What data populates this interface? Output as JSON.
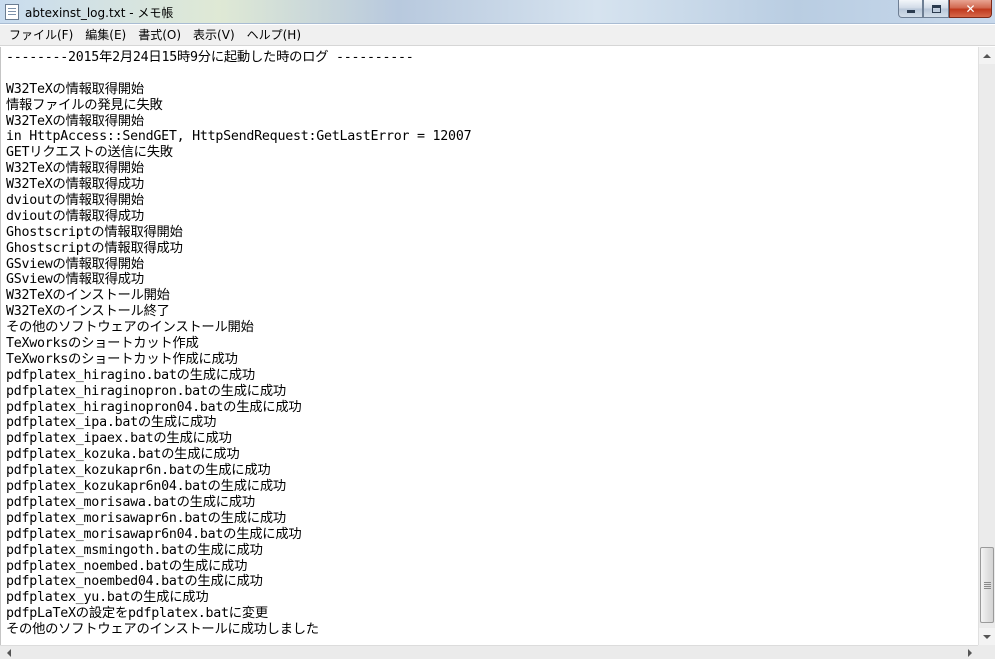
{
  "window": {
    "title": "abtexinst_log.txt - メモ帳",
    "icon": "notepad-icon"
  },
  "menu": [
    {
      "label": "ファイル(F)"
    },
    {
      "label": "編集(E)"
    },
    {
      "label": "書式(O)"
    },
    {
      "label": "表示(V)"
    },
    {
      "label": "ヘルプ(H)"
    }
  ],
  "document": {
    "lines": [
      "--------2015年2月24日15時9分に起動した時のログ ----------",
      "",
      "W32TeXの情報取得開始",
      "情報ファイルの発見に失敗",
      "W32TeXの情報取得開始",
      "in HttpAccess::SendGET, HttpSendRequest:GetLastError = 12007",
      "GETリクエストの送信に失敗",
      "W32TeXの情報取得開始",
      "W32TeXの情報取得成功",
      "dvioutの情報取得開始",
      "dvioutの情報取得成功",
      "Ghostscriptの情報取得開始",
      "Ghostscriptの情報取得成功",
      "GSviewの情報取得開始",
      "GSviewの情報取得成功",
      "W32TeXのインストール開始",
      "W32TeXのインストール終了",
      "その他のソフトウェアのインストール開始",
      "TeXworksのショートカット作成",
      "TeXworksのショートカット作成に成功",
      "pdfplatex_hiragino.batの生成に成功",
      "pdfplatex_hiraginopron.batの生成に成功",
      "pdfplatex_hiraginopron04.batの生成に成功",
      "pdfplatex_ipa.batの生成に成功",
      "pdfplatex_ipaex.batの生成に成功",
      "pdfplatex_kozuka.batの生成に成功",
      "pdfplatex_kozukapr6n.batの生成に成功",
      "pdfplatex_kozukapr6n04.batの生成に成功",
      "pdfplatex_morisawa.batの生成に成功",
      "pdfplatex_morisawapr6n.batの生成に成功",
      "pdfplatex_morisawapr6n04.batの生成に成功",
      "pdfplatex_msmingoth.batの生成に成功",
      "pdfplatex_noembed.batの生成に成功",
      "pdfplatex_noembed04.batの生成に成功",
      "pdfplatex_yu.batの生成に成功",
      "pdfpLaTeXの設定をpdfplatex.batに変更",
      "その他のソフトウェアのインストールに成功しました"
    ]
  }
}
